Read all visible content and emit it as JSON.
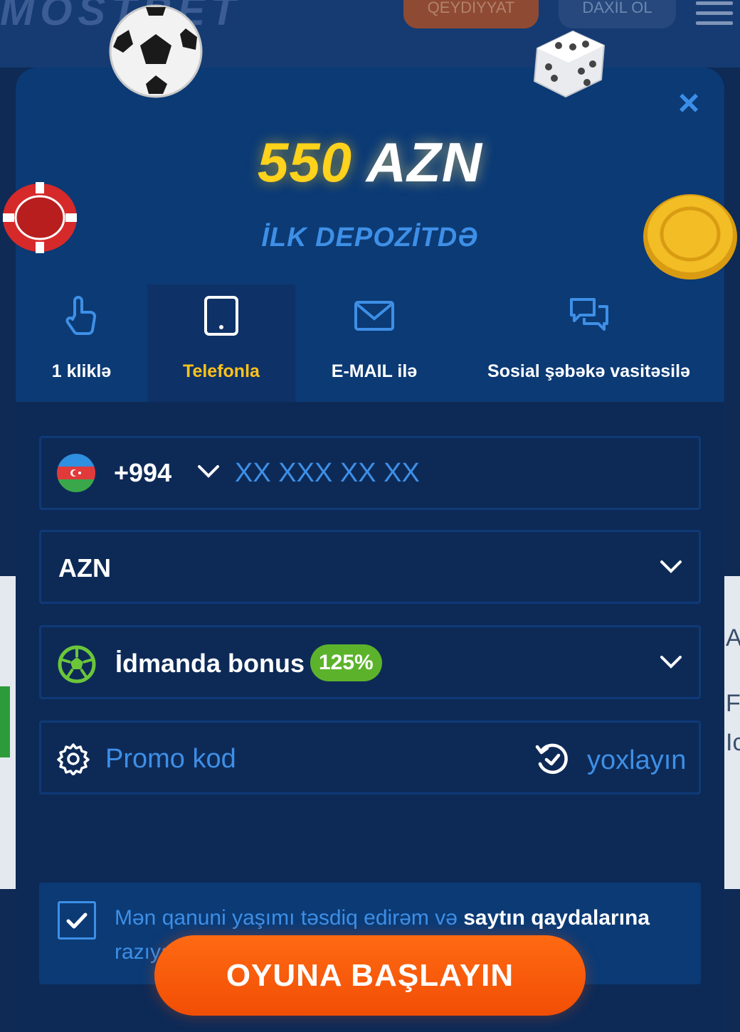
{
  "background": {
    "logo": "MOSTBET",
    "register_button": "QEYDİYYAT",
    "login_button": "DAXİL OL",
    "side_letters": [
      "A",
      "F",
      "Ic"
    ]
  },
  "modal": {
    "close_glyph": "×",
    "bonus_amount_number": "550",
    "bonus_amount_currency": "AZN",
    "bonus_subtitle": "İLK DEPOZİTDƏ",
    "tabs": [
      {
        "label": "1 kliklə",
        "icon": "hand-pointer-icon",
        "active": false
      },
      {
        "label": "Telefonla",
        "icon": "phone-icon",
        "active": true
      },
      {
        "label": "E-MAIL ilə",
        "icon": "envelope-icon",
        "active": false
      },
      {
        "label": "Sosial şəbəkə vasitəsilə",
        "icon": "chat-bubbles-icon",
        "active": false
      }
    ],
    "phone": {
      "country_code": "+994",
      "placeholder": "XX XXX XX XX",
      "value": ""
    },
    "currency": {
      "selected": "AZN"
    },
    "bonus": {
      "label": "İdmanda bonus",
      "badge": "125%"
    },
    "promo": {
      "placeholder": "Promo kod",
      "verify_label": "yoxlayın"
    },
    "terms": {
      "text": "Mən qanuni yaşımı təsdiq edirəm və",
      "link": "saytın qaydalarına",
      "text_end": "razıyam",
      "checked": true
    },
    "submit_label": "OYUNA BAŞLAYIN"
  },
  "colors": {
    "modal_bg": "#0d2a57",
    "accent_blue": "#3e8fe6",
    "accent_yellow": "#ffd21c",
    "active_tab_text": "#ffc21a",
    "badge_green": "#5cb32b",
    "button_orange": "#f6600d"
  }
}
